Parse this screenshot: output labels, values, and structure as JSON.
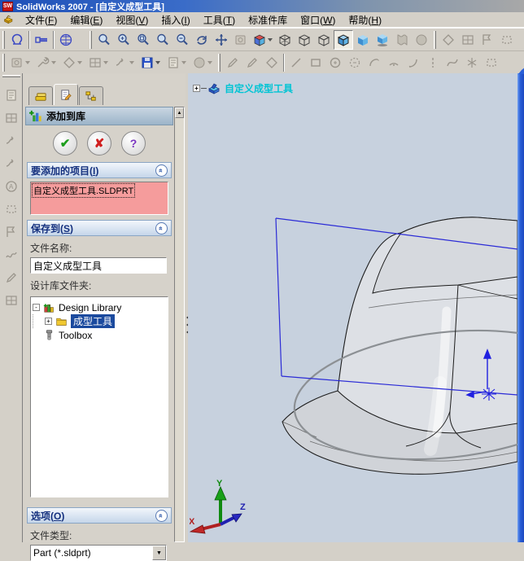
{
  "window": {
    "title": "SolidWorks 2007 - [自定义成型工具]"
  },
  "menu": {
    "items": [
      "文件(F)",
      "编辑(E)",
      "视图(V)",
      "插入(I)",
      "工具(T)",
      "标准件库",
      "窗口(W)",
      "帮助(H)"
    ]
  },
  "toolbars": {
    "row1_icons": [
      "forming-tool-icon",
      "bolt-icon",
      "mesh-sphere-icon",
      "view-orientation-icon",
      "zoom-fit-icon",
      "zoom-area-icon",
      "zoom-inout-icon",
      "zoom-selection-icon",
      "rotate-view-icon",
      "pan-icon",
      "previous-view-icon",
      "standard-views-cube-icon",
      "wireframe-icon",
      "hidden-lines-visible-icon",
      "hidden-lines-removed-icon",
      "shaded-with-edges-icon",
      "shaded-icon",
      "shadows-icon",
      "section-view-icon",
      "realview-icon"
    ],
    "row2_icons": [
      "features-flyout-icon",
      "sketch-flyout-icon",
      "surfaces-flyout-icon",
      "tools-flyout-icon",
      "dimension-flyout-icon",
      "save-flyout-icon",
      "assembly-flyout-icon",
      "sw-flyout-icon",
      "sketch-icon",
      "sketch3d-icon",
      "smart-dimension-icon",
      "line-icon",
      "rectangle-icon",
      "circle-icon",
      "perimeter-circle-icon",
      "centerpoint-arc-icon",
      "tangent-arc-icon",
      "three-point-arc-icon",
      "centerline-icon",
      "spline-icon",
      "point-icon",
      "trim-icon"
    ]
  },
  "panel": {
    "tabs": [
      "featuremanager-tab",
      "propertymanager-tab",
      "configurationmanager-tab"
    ],
    "header": {
      "title": "添加到库"
    },
    "actions": {
      "ok": "✔",
      "cancel": "✘",
      "help": "?"
    },
    "items_to_add": {
      "title": "要添加的项目(I)",
      "items": [
        "自定义成型工具.SLDPRT"
      ]
    },
    "save_to": {
      "title": "保存到(S)",
      "file_name_label": "文件名称:",
      "file_name_value": "自定义成型工具",
      "folder_label": "设计库文件夹:",
      "tree": [
        {
          "label": "Design Library"
        },
        {
          "label": "成型工具",
          "selected": true
        },
        {
          "label": "Toolbox"
        }
      ]
    },
    "options": {
      "title": "选项(O)",
      "file_type_label": "文件类型:",
      "file_type_value": "Part (*.sldprt)"
    }
  },
  "viewport": {
    "feature_label": "自定义成型工具",
    "triad": {
      "x": "X",
      "y": "Y",
      "z": "Z"
    }
  },
  "colors": {
    "titlebar_blue": "#1d4fb8",
    "viewport_bg": "#c7d1de",
    "sketch_blue": "#2b2bd6",
    "selection_navy": "#1b4a9e",
    "warning_salmon": "#f59c9c",
    "feature_label_cyan": "#00c4d4",
    "window_border_blue": "#2a5fd8"
  }
}
